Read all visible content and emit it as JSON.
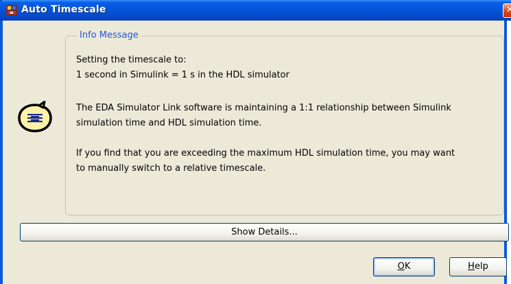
{
  "window": {
    "title": "Auto Timescale",
    "close_glyph": "✕"
  },
  "info": {
    "legend": "Info Message",
    "line1": "Setting the timescale to:",
    "line2": "1 second in Simulink = 1 s in the HDL simulator",
    "line3": "The EDA Simulator Link software is maintaining a 1:1 relationship between Simulink",
    "line4": "simulation time and HDL simulation time.",
    "line5": "If you find that you are exceeding the maximum HDL simulation time, you may want",
    "line6": "to manually switch to a relative timescale."
  },
  "buttons": {
    "show_details": "Show Details...",
    "ok_mnemonic": "O",
    "ok_rest": "K",
    "help_mnemonic": "H",
    "help_rest": "elp"
  },
  "icons": {
    "app": "simulink-app-icon",
    "message": "speech-bubble-info-icon",
    "close": "close-icon"
  },
  "colors": {
    "titlebar": "#0453d8",
    "dialog_bg": "#ece9d8",
    "legend_text": "#2155e0",
    "close_button": "#de4a1e"
  }
}
